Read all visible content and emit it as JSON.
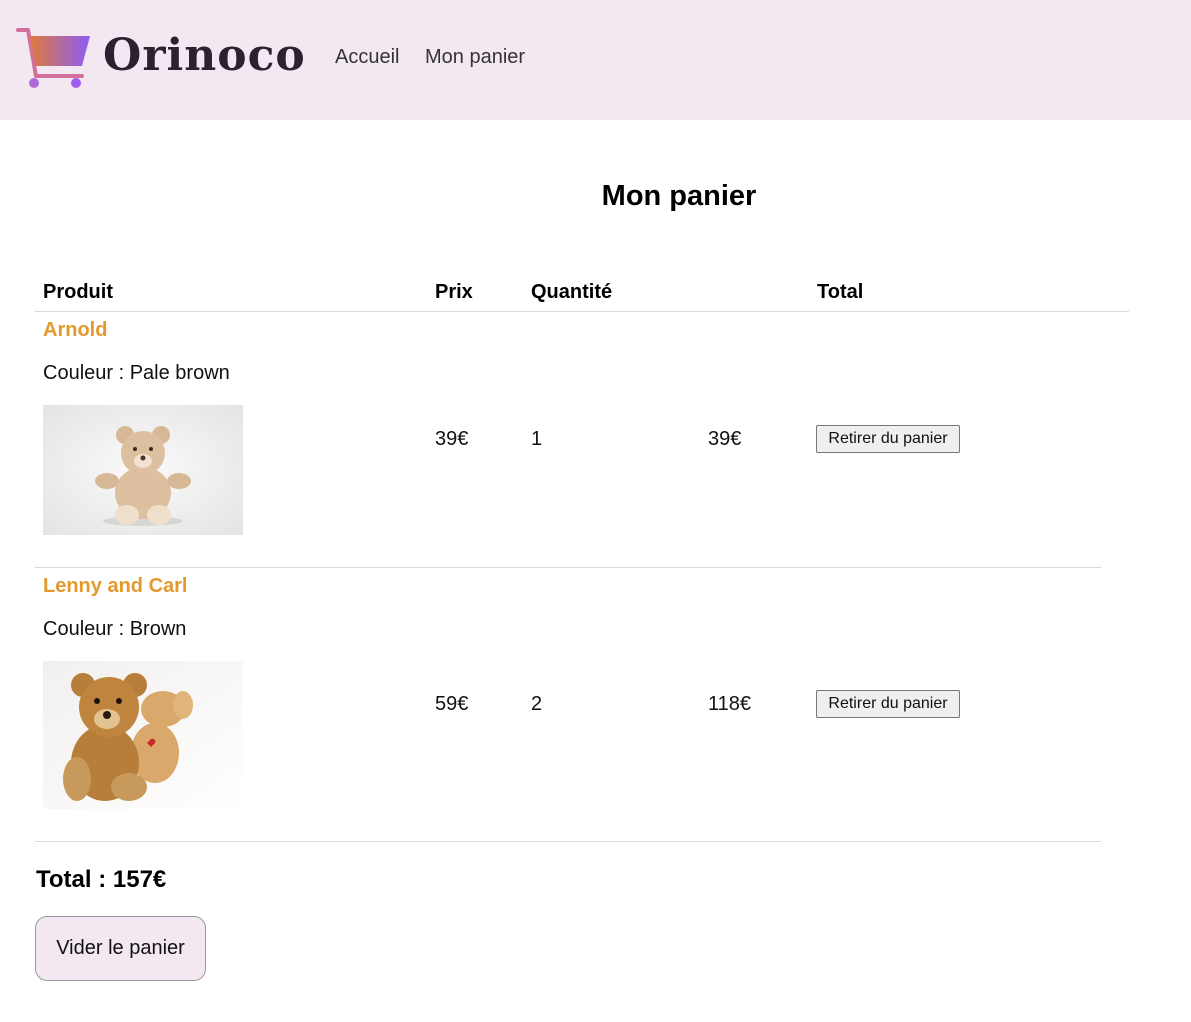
{
  "header": {
    "brand": "Orinoco",
    "logo_icon": "shopping-cart-icon",
    "nav": {
      "home": "Accueil",
      "cart": "Mon panier"
    }
  },
  "page_title": "Mon panier",
  "table": {
    "headers": {
      "product": "Produit",
      "price": "Prix",
      "quantity": "Quantité",
      "total": "Total"
    },
    "rows": [
      {
        "name": "Arnold",
        "color": "Couleur : Pale brown",
        "image": "teddy-bear-pale-brown",
        "price": "39€",
        "quantity": "1",
        "total": "39€",
        "remove_label": "Retirer du panier"
      },
      {
        "name": "Lenny and Carl",
        "color": "Couleur : Brown",
        "image": "teddy-bears-brown-pair",
        "price": "59€",
        "quantity": "2",
        "total": "118€",
        "remove_label": "Retirer du panier"
      }
    ]
  },
  "grand_total": "Total : 157€",
  "empty_cart_label": "Vider le panier",
  "colors": {
    "header_bg": "#f3e8f1",
    "product_name": "#e39a2d",
    "logo_gradient_start": "#e07a3c",
    "logo_gradient_end": "#8a5cf5"
  }
}
